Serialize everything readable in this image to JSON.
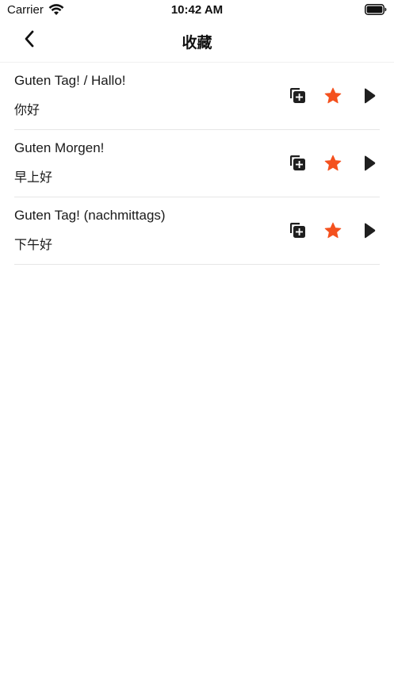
{
  "status_bar": {
    "carrier": "Carrier",
    "time": "10:42 AM",
    "wifi_icon": "wifi-icon",
    "battery_icon": "battery-icon"
  },
  "nav": {
    "title": "收藏",
    "back_icon": "chevron-left-icon"
  },
  "colors": {
    "accent_star": "#f4511e",
    "icon_dark": "#1f1f1f",
    "divider": "#e6e6e6"
  },
  "items": [
    {
      "german": "Guten Tag! / Hallo!",
      "chinese": "你好"
    },
    {
      "german": "Guten Morgen!",
      "chinese": "早上好"
    },
    {
      "german": "Guten Tag! (nachmittags)",
      "chinese": "下午好"
    }
  ],
  "item_actions": [
    "copy-add-icon",
    "star-icon",
    "play-icon"
  ]
}
